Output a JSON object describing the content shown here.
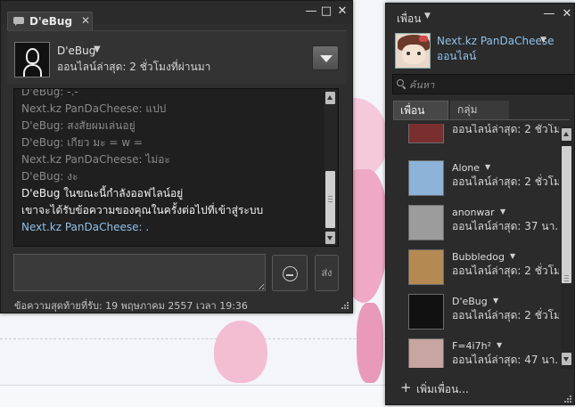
{
  "chat_window": {
    "tab_title": "D'eBug",
    "tab_close": "✕",
    "peer": {
      "name": "D'eBug",
      "status": "ออนไลน์ล่าสุด: 2 ชั่วโมงที่ผ่านมา"
    },
    "log": [
      {
        "sender": "D'eBug",
        "text": "-.-",
        "style": "old"
      },
      {
        "sender": "Next.kz PanDaCheese",
        "text": "แปป",
        "style": "old"
      },
      {
        "sender": "D'eBug",
        "text": "สงสัยผมเล่นอยู่",
        "style": "old"
      },
      {
        "sender": "D'eBug",
        "text": "เกียว มะ = w =",
        "style": "old"
      },
      {
        "sender": "Next.kz PanDaCheese",
        "text": "ไม่อะ",
        "style": "old"
      },
      {
        "sender": "D'eBug",
        "text": "งะ",
        "style": "old"
      },
      {
        "sender": "",
        "text": "D'eBug ในขณะนี้กำลังออฟไลน์อยู่",
        "style": "white"
      },
      {
        "sender": "",
        "text": "เขาจะได้รับข้อความของคุณในครั้งต่อไปที่เข้าสู่ระบบ",
        "style": "white"
      },
      {
        "sender": "Next.kz PanDaCheese",
        "text": ".",
        "style": "blue"
      }
    ],
    "input_value": "",
    "send_label": "ส่ง",
    "footer": "ข้อความสุดท้ายที่รับ: 19 พฤษภาคม 2557 เวลา 19:36",
    "scroll_position": 0.85
  },
  "friends_window": {
    "title": "เพื่อน",
    "me": {
      "name": "Next.kz PanDaCheese",
      "status": "ออนไลน์"
    },
    "search": {
      "placeholder": "ค้นหา",
      "value": ""
    },
    "tabs": [
      {
        "label": "เพื่อน",
        "selected": true
      },
      {
        "label": "กลุ่ม",
        "selected": false
      }
    ],
    "friends": [
      {
        "name": "",
        "status": "ออนไลน์ล่าสุด: 2 ชั่วโม...",
        "avatar_color": "#7a2f2f"
      },
      {
        "name": "Alone",
        "status": "ออนไลน์ล่าสุด: 2 ชั่วโม...",
        "avatar_color": "#8db3d9"
      },
      {
        "name": "anonwar",
        "status": "ออนไลน์ล่าสุด: 37 นา...",
        "avatar_color": "#9c9c9c"
      },
      {
        "name": "Bubbledog",
        "status": "ออนไลน์ล่าสุด: 2 ชั่วโม...",
        "avatar_color": "#b58a52"
      },
      {
        "name": "D'eBug",
        "status": "ออนไลน์ล่าสุด: 2 ชั่วโม...",
        "avatar_color": "#111111"
      },
      {
        "name": "F=4i7h²",
        "status": "ออนไลน์ล่าสุด: 47 นา...",
        "avatar_color": "#c7a5a0"
      }
    ],
    "add_friend_label": "เพิ่มเพื่อน..."
  },
  "colors": {
    "window_bg": "#2e2e2e",
    "link_blue": "#8fc1ea",
    "log_bg": "#1f1f1f"
  }
}
